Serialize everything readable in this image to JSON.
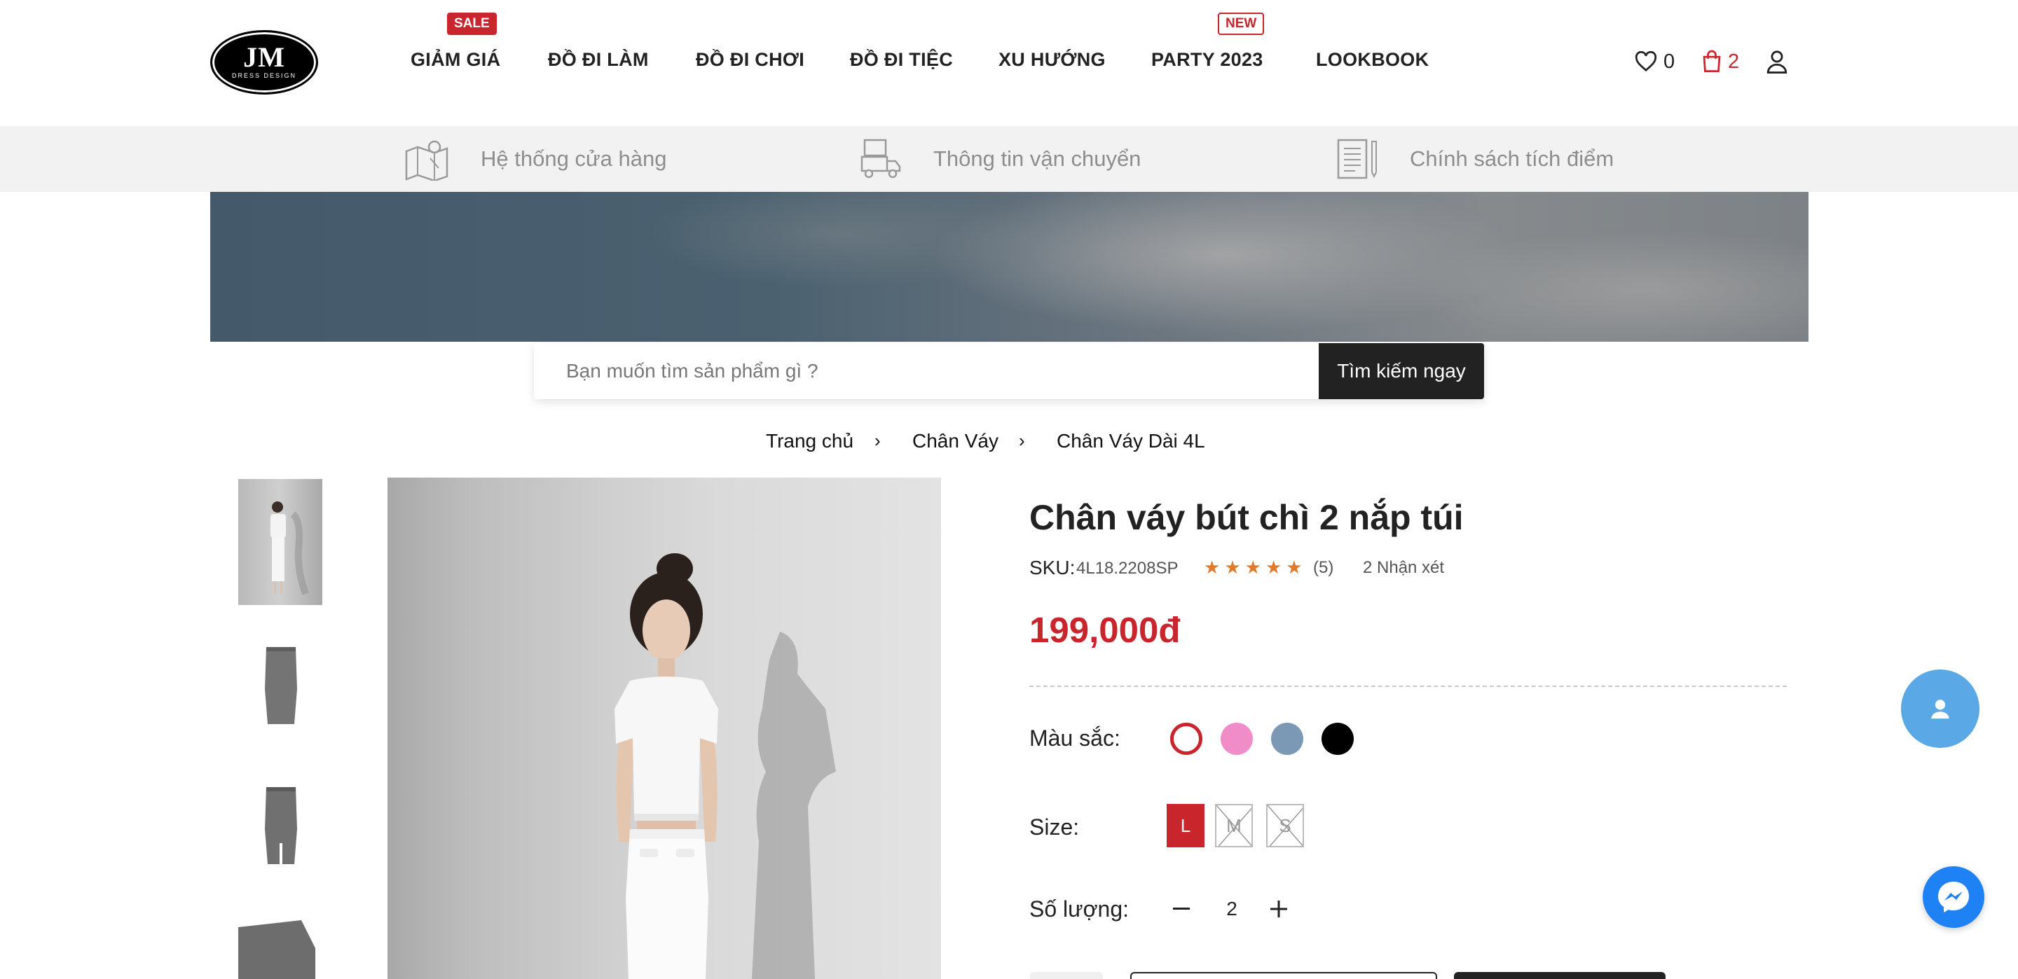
{
  "logo": {
    "mark": "JM",
    "subtitle": "DRESS DESIGN"
  },
  "nav": {
    "items": [
      {
        "label": "GIẢM GIÁ"
      },
      {
        "label": "ĐỒ ĐI LÀM"
      },
      {
        "label": "ĐỒ ĐI CHƠI"
      },
      {
        "label": "ĐỒ ĐI TIỆC"
      },
      {
        "label": "XU HƯỚNG"
      },
      {
        "label": "PARTY 2023"
      },
      {
        "label": "LOOKBOOK"
      }
    ],
    "sale_badge": "SALE",
    "new_badge": "NEW"
  },
  "header_icons": {
    "wishlist_count": "0",
    "cart_count": "2"
  },
  "info_strip": [
    {
      "label": "Hệ thống cửa hàng",
      "icon": "map-icon"
    },
    {
      "label": "Thông tin vận chuyển",
      "icon": "delivery-truck-icon"
    },
    {
      "label": "Chính sách tích điểm",
      "icon": "document-pen-icon"
    }
  ],
  "search": {
    "placeholder": "Bạn muốn tìm sản phẩm gì ?",
    "button_label": "Tìm kiếm ngay"
  },
  "breadcrumb": [
    "Trang chủ",
    "Chân Váy",
    "Chân Váy Dài 4L"
  ],
  "product": {
    "title": "Chân váy bút chì 2 nắp túi",
    "sku_label": "SKU:",
    "sku": "4L18.2208SP",
    "rating_stars": 5,
    "rating_count": "(5)",
    "reviews": "2 Nhận xét",
    "price": "199,000đ",
    "color_label": "Màu sắc:",
    "colors": [
      "#ffffff",
      "#f08dc9",
      "#7b98b4",
      "#000000"
    ],
    "selected_color": "#ffffff",
    "size_label": "Size:",
    "sizes": [
      {
        "label": "L",
        "available": true,
        "selected": true
      },
      {
        "label": "M",
        "available": false,
        "selected": false
      },
      {
        "label": "S",
        "available": false,
        "selected": false
      }
    ],
    "qty_label": "Số lượng:",
    "quantity": "2"
  },
  "colors": {
    "accent": "#c8252c",
    "dark": "#222222",
    "strip_bg": "#f2f2f2",
    "chat_fab": "#5aa9e6",
    "messenger": "#1e82f5",
    "star": "#e07b2d"
  }
}
